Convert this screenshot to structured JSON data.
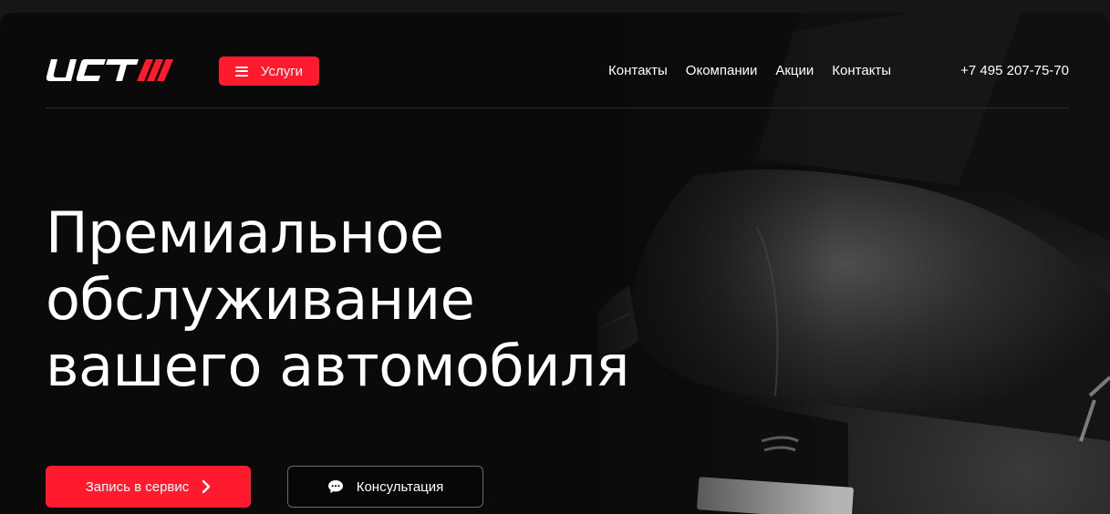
{
  "header": {
    "logo_text": "UCT",
    "services_button": "Услуги",
    "nav": [
      "Контакты",
      "Окомпании",
      "Акции",
      "Контакты"
    ],
    "phone": "+7 495 207-75-70"
  },
  "hero": {
    "headline": [
      "Премиальное",
      "обслуживание",
      "вашего автомобиля"
    ],
    "primary_button": "Запись в сервис",
    "secondary_button": "Консультация"
  },
  "colors": {
    "accent": "#ff1a2e",
    "background": "#0a0a0a",
    "text": "#ffffff"
  },
  "icons": {
    "services": "menu-icon",
    "primary": "chevron-right-icon",
    "secondary": "chat-bubble-icon",
    "background": "car-photo"
  }
}
